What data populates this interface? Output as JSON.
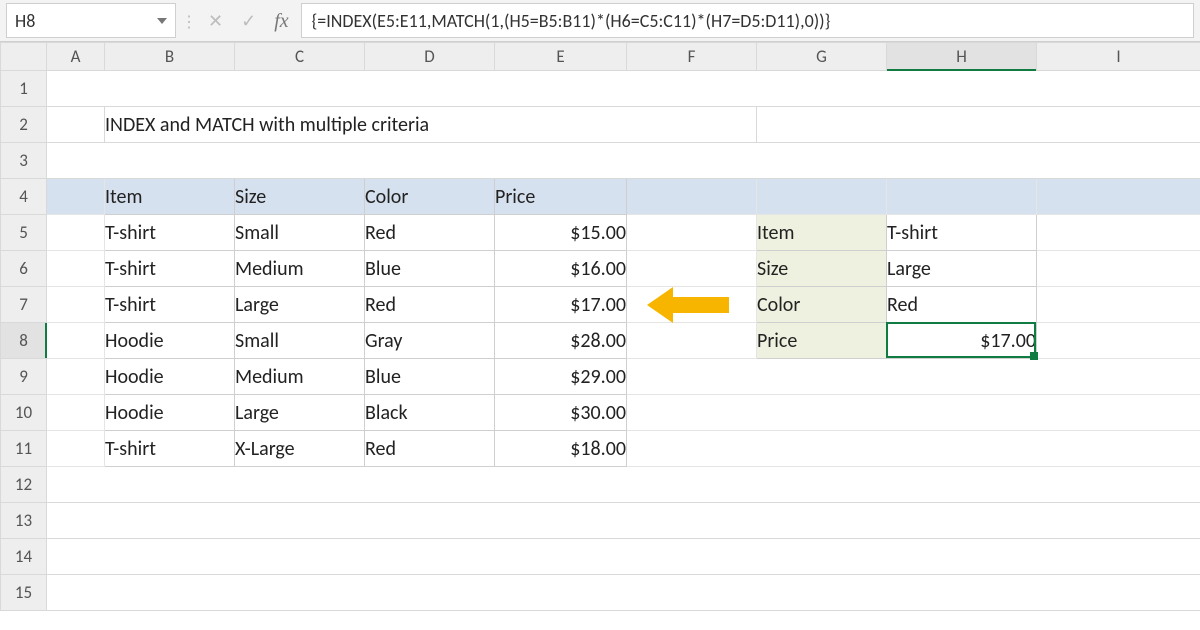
{
  "namebox": "H8",
  "formula": "{=INDEX(E5:E11,MATCH(1,(H5=B5:B11)*(H6=C5:C11)*(H7=D5:D11),0))}",
  "columns": [
    "A",
    "B",
    "C",
    "D",
    "E",
    "F",
    "G",
    "H",
    "I"
  ],
  "active_col": "H",
  "active_row": "8",
  "title": "INDEX and MATCH with multiple criteria",
  "table": {
    "headers": {
      "item": "Item",
      "size": "Size",
      "color": "Color",
      "price": "Price"
    },
    "rows": [
      {
        "item": "T-shirt",
        "size": "Small",
        "color": "Red",
        "price": "$15.00"
      },
      {
        "item": "T-shirt",
        "size": "Medium",
        "color": "Blue",
        "price": "$16.00"
      },
      {
        "item": "T-shirt",
        "size": "Large",
        "color": "Red",
        "price": "$17.00"
      },
      {
        "item": "Hoodie",
        "size": "Small",
        "color": "Gray",
        "price": "$28.00"
      },
      {
        "item": "Hoodie",
        "size": "Medium",
        "color": "Blue",
        "price": "$29.00"
      },
      {
        "item": "Hoodie",
        "size": "Large",
        "color": "Black",
        "price": "$30.00"
      },
      {
        "item": "T-shirt",
        "size": "X-Large",
        "color": "Red",
        "price": "$18.00"
      }
    ]
  },
  "lookup": {
    "labels": {
      "item": "Item",
      "size": "Size",
      "color": "Color",
      "price": "Price"
    },
    "values": {
      "item": "T-shirt",
      "size": "Large",
      "color": "Red",
      "price": "$17.00"
    }
  },
  "icons": {
    "cancel": "✕",
    "enter": "✓",
    "fx": "fx"
  }
}
